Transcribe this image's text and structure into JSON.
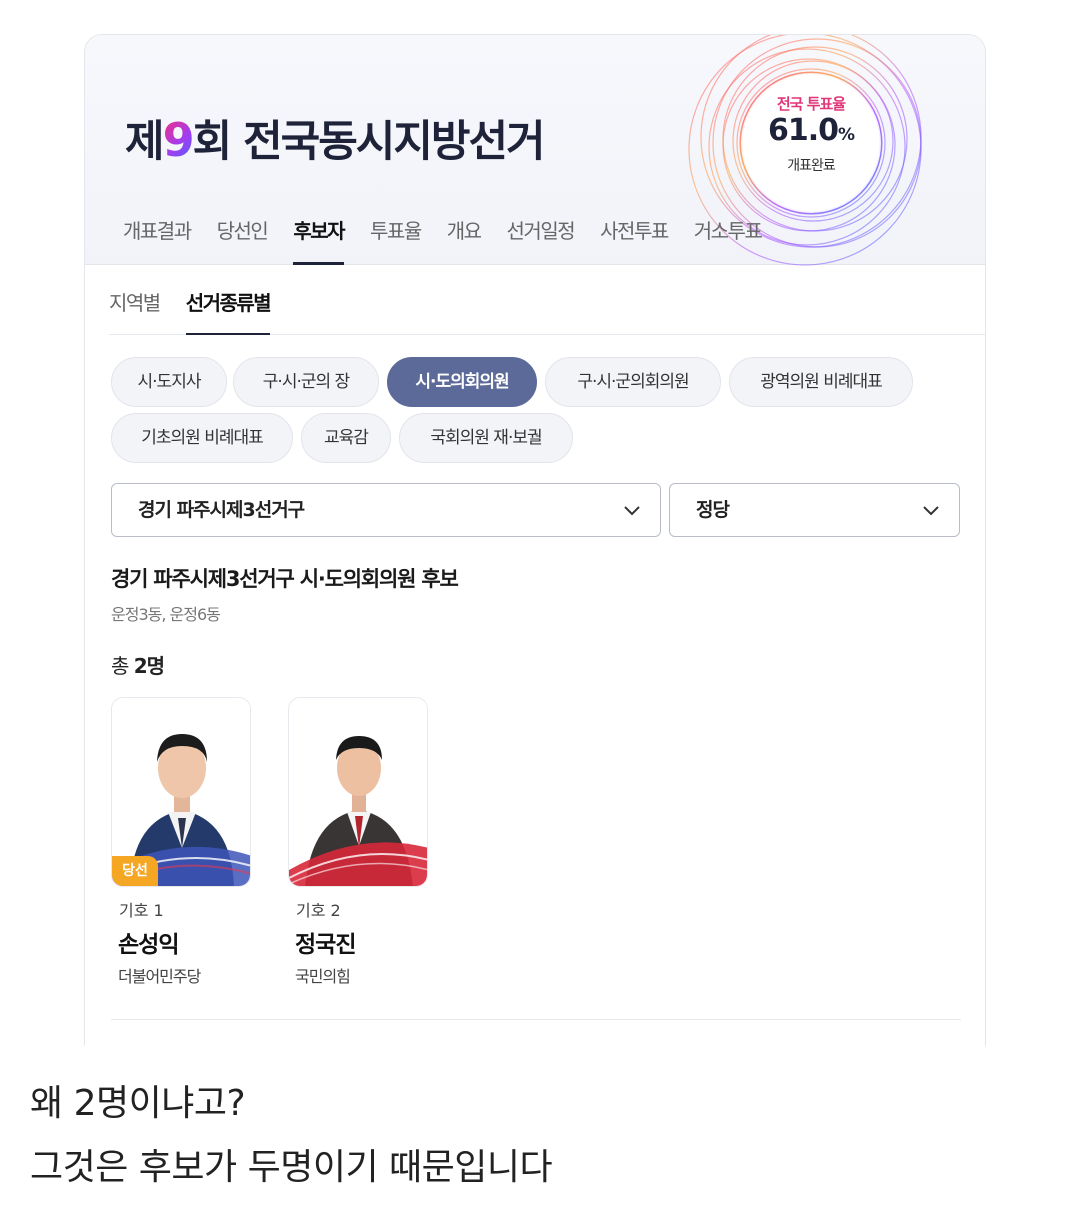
{
  "header": {
    "election_title_prefix": "제",
    "election_number": "9",
    "election_title_suffix": "회 전국동시지방선거",
    "turnout_label": "전국 투표율",
    "turnout_value": "61.0",
    "turnout_unit": "%",
    "count_status": "개표완료"
  },
  "main_tabs": [
    "개표결과",
    "당선인",
    "후보자",
    "투표율",
    "개요",
    "선거일정",
    "사전투표",
    "거소투표"
  ],
  "main_tab_active": "후보자",
  "sub_tabs": [
    "지역별",
    "선거종류별"
  ],
  "sub_tab_active": "선거종류별",
  "election_types": [
    "시·도지사",
    "구·시·군의 장",
    "시·도의회의원",
    "구·시·군의회의원",
    "광역의원 비례대표",
    "기초의원 비례대표",
    "교육감",
    "국회의원 재·보궐"
  ],
  "election_type_active": "시·도의회의원",
  "filters": {
    "district": "경기 파주시제3선거구",
    "party": "정당"
  },
  "result": {
    "title": "경기 파주시제3선거구 시·도의회의원 후보",
    "area": "운정3동, 운정6동",
    "total_prefix": "총",
    "total_count": "2명"
  },
  "candidates": [
    {
      "number": "기호 1",
      "name": "손성익",
      "party": "더불어민주당",
      "badge": "당선",
      "accent": "#2b4aa8"
    },
    {
      "number": "기호 2",
      "name": "정국진",
      "party": "국민의힘",
      "badge": "",
      "accent": "#d8283a"
    }
  ],
  "captions": [
    "왜 2명이냐고?",
    "그것은 후보가 두명이기 때문입니다"
  ],
  "colors": {
    "chip_active": "#5b6a98",
    "winner_badge": "#f5a623",
    "title_dark": "#1f2339"
  }
}
